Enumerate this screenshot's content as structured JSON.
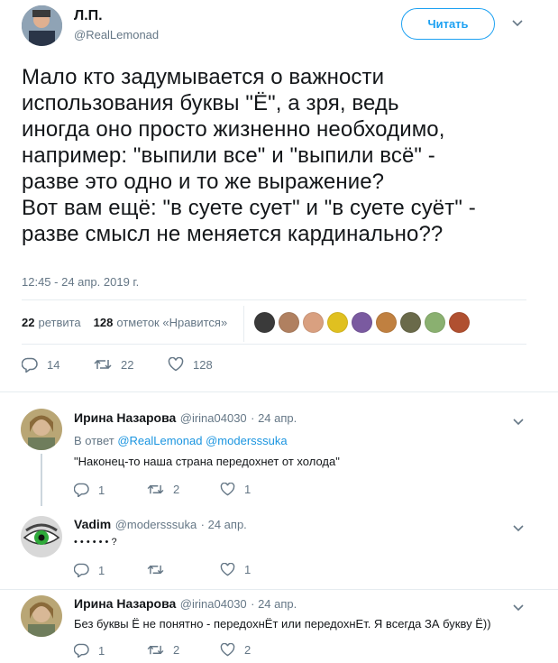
{
  "tweet": {
    "author_name": "Л.П.",
    "author_handle": "@RealLemonad",
    "follow_label": "Читать",
    "text": "Мало кто задумывается о важности\nиспользования буквы \"Ё\", а зря, ведь\nиногда оно просто жизненно необходимо,\nнапример: \"выпили все\" и \"выпили всё\" -\nразве это одно и то же выражение?\nВот вам ещё: \"в суете сует\" и \"в суете суёт\" -\nразве смысл не меняется кардинально??",
    "timestamp": "12:45 - 24 апр. 2019 г.",
    "retweets_count": "22",
    "retweets_label": "ретвита",
    "likes_count": "128",
    "likes_label": "отметок «Нравится»",
    "actions": {
      "replies": "14",
      "retweets": "22",
      "likes": "128"
    },
    "likers_colors": [
      "#3a3a3a",
      "#b08060",
      "#d9a080",
      "#e0c020",
      "#7a5aa0",
      "#c08040",
      "#6a6a4a",
      "#8ab070",
      "#b05030"
    ]
  },
  "replies": [
    {
      "name": "Ирина Назарова",
      "handle": "@irina04030",
      "date": "· 24 апр.",
      "reply_prefix": "В ответ",
      "reply_to": [
        "@RealLemonad",
        "@modersssuka"
      ],
      "text": "\"Наконец-то наша страна передохнет от холода\"",
      "replies": "1",
      "retweets": "2",
      "likes": "1"
    },
    {
      "name": "Vadim",
      "handle": "@modersssuka",
      "date": "· 24 апр.",
      "text": "• • • • • • ?",
      "replies": "1",
      "retweets": "",
      "likes": "1"
    },
    {
      "name": "Ирина Назарова",
      "handle": "@irina04030",
      "date": "· 24 апр.",
      "text": "Без буквы Ё не понятно - передохнЁт или передохнЕт. Я всегда ЗА букву Ё))",
      "replies": "1",
      "retweets": "2",
      "likes": "2"
    }
  ],
  "colors": {
    "accent": "#1da1f2",
    "link": "#1b95e0",
    "muted": "#657786"
  }
}
